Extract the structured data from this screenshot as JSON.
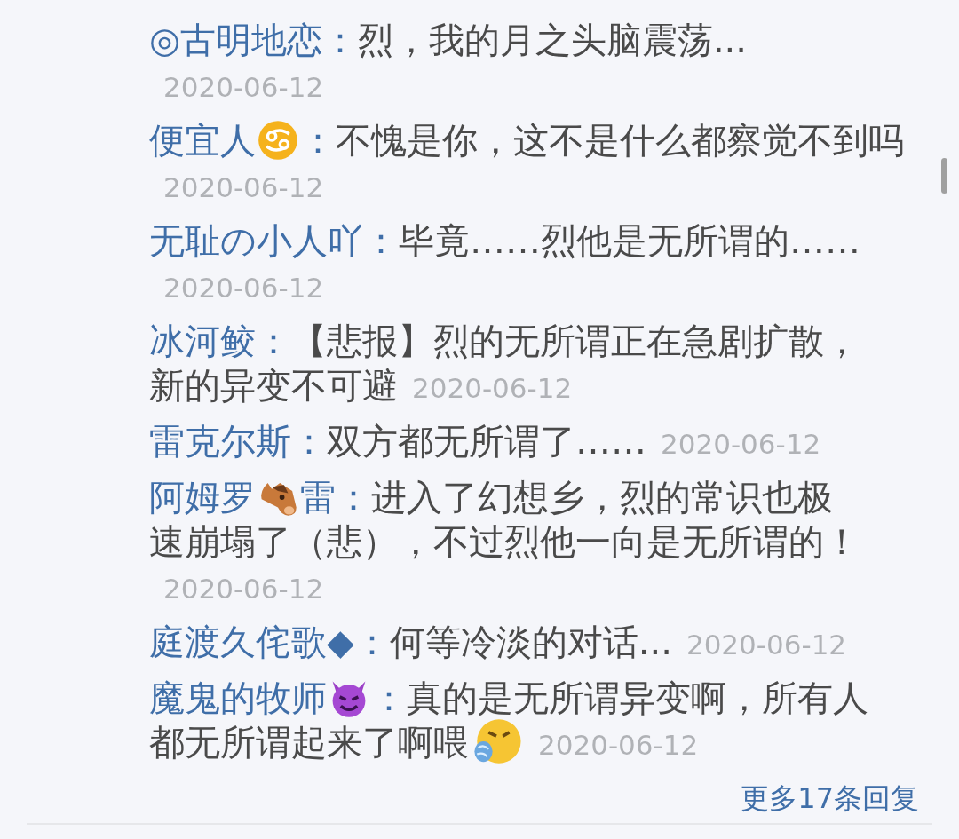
{
  "replies": [
    {
      "name": [
        {
          "kind": "text",
          "text": "◎古明地恋"
        }
      ],
      "message": [
        {
          "kind": "text",
          "text": "烈，我的月之头脑震荡..."
        }
      ],
      "date": "2020-06-12"
    },
    {
      "name": [
        {
          "kind": "text",
          "text": "便宜人"
        },
        {
          "kind": "zodiac"
        }
      ],
      "message": [
        {
          "kind": "text",
          "text": "不愧是你，这不是什么都察觉不到"
        },
        {
          "kind": "text",
          "text": "吗"
        }
      ],
      "date": "2020-06-12"
    },
    {
      "name": [
        {
          "kind": "text",
          "text": "无耻の小人吖"
        }
      ],
      "message": [
        {
          "kind": "text",
          "text": "毕竟……烈他是无所谓的……"
        }
      ],
      "date": "2020-06-12"
    },
    {
      "name": [
        {
          "kind": "text",
          "text": "冰河鲛"
        }
      ],
      "message": [
        {
          "kind": "text",
          "text": "【悲报】烈的无所谓正在急剧扩散，"
        },
        {
          "kind": "text",
          "text": "新的异变不可避"
        }
      ],
      "date": "2020-06-12"
    },
    {
      "name": [
        {
          "kind": "text",
          "text": "雷克尔斯"
        }
      ],
      "message": [
        {
          "kind": "text",
          "text": "双方都无所谓了……"
        }
      ],
      "date": "2020-06-12"
    },
    {
      "name": [
        {
          "kind": "text",
          "text": "阿姆罗"
        },
        {
          "kind": "horse"
        },
        {
          "kind": "text",
          "text": "雷"
        }
      ],
      "message": [
        {
          "kind": "text",
          "text": "进入了幻想乡，烈的常识也极"
        },
        {
          "kind": "text",
          "text": "速崩塌了（悲），不过烈他一向是无所谓的！"
        }
      ],
      "date": "2020-06-12"
    },
    {
      "name": [
        {
          "kind": "text",
          "text": "庭渡久侘歌◆"
        }
      ],
      "message": [
        {
          "kind": "text",
          "text": "何等冷淡的对话..."
        }
      ],
      "date": "2020-06-12"
    },
    {
      "name": [
        {
          "kind": "text",
          "text": "魔鬼的牧师"
        },
        {
          "kind": "devil"
        }
      ],
      "message": [
        {
          "kind": "text",
          "text": "真的是无所谓异变啊，所有人"
        },
        {
          "kind": "text",
          "text": "都无所谓起来了啊喂"
        },
        {
          "kind": "fume"
        }
      ],
      "date": "2020-06-12"
    }
  ],
  "colon": "：",
  "more_link": "更多17条回复"
}
